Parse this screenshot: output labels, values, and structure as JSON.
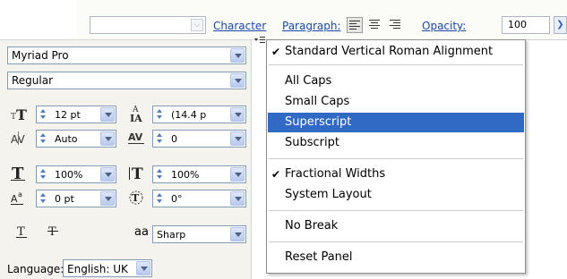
{
  "options_bar": {
    "font_family_value": "",
    "character_link": "Character",
    "paragraph_link": "Paragraph:",
    "opacity_link": "Opacity:",
    "opacity_value": "100",
    "align_buttons": [
      "align-left-icon",
      "align-center-icon",
      "align-right-icon"
    ],
    "selected_align": "align-left-icon"
  },
  "character_panel": {
    "font_family": "Myriad Pro",
    "font_style": "Regular",
    "font_size": "12 pt",
    "leading": "(14.4 p",
    "kerning": "Auto",
    "tracking": "0",
    "vertical_scale": "100%",
    "horizontal_scale": "100%",
    "baseline_shift": "0 pt",
    "rotation": "0°",
    "anti_alias_icon_text": "aa",
    "anti_alias": "Sharp",
    "language_label": "Language:",
    "language": "English: UK"
  },
  "flyout_menu": {
    "items": [
      {
        "label": "Standard Vertical Roman Alignment",
        "checked": true
      },
      {
        "label": "All Caps",
        "checked": false
      },
      {
        "label": "Small Caps",
        "checked": false
      },
      {
        "label": "Superscript",
        "checked": false,
        "highlighted": true
      },
      {
        "label": "Subscript",
        "checked": false
      },
      {
        "label": "Fractional Widths",
        "checked": true
      },
      {
        "label": "System Layout",
        "checked": false
      },
      {
        "label": "No Break",
        "checked": false
      },
      {
        "label": "Reset Panel",
        "checked": false
      }
    ],
    "check_glyph": "✔"
  },
  "colors": {
    "menu_highlight": "#316ac5",
    "link": "#1a4aa8",
    "panel_bg": "#f4f3ee"
  }
}
